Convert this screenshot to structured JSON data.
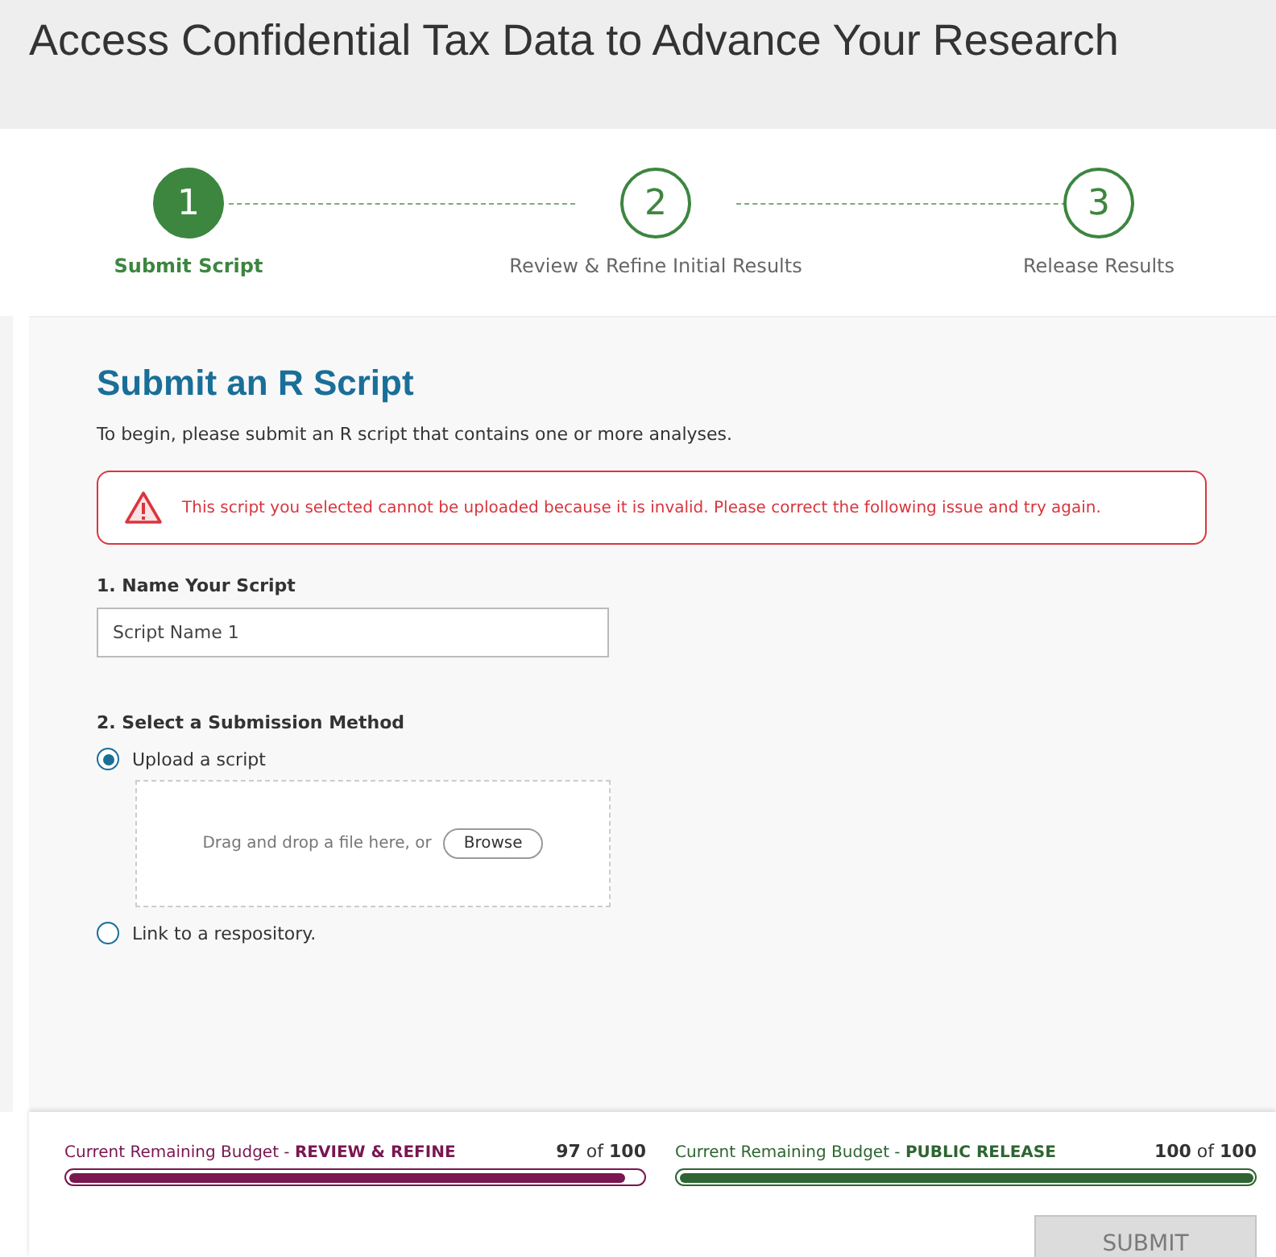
{
  "header": {
    "title": "Access Confidential Tax Data to Advance Your Research"
  },
  "steps": [
    {
      "number": "1",
      "label": "Submit Script",
      "selected": true
    },
    {
      "number": "2",
      "label": "Review & Refine Initial Results",
      "selected": false
    },
    {
      "number": "3",
      "label": "Release Results",
      "selected": false
    }
  ],
  "form": {
    "title": "Submit an R Script",
    "intro": "To begin, please submit an R script that contains one or more analyses.",
    "error": "This script you selected cannot be uploaded because it is invalid. Please correct the following issue and try again.",
    "name_label": "1. Name Your Script",
    "name_value": "Script Name 1",
    "method_label": "2. Select a Submission Method",
    "methods": [
      {
        "label": "Upload a script",
        "selected": true,
        "dropzone": {
          "text": "Drag and drop a file here, or",
          "button": "Browse"
        }
      },
      {
        "label": "Link to a respository.",
        "selected": false
      }
    ]
  },
  "budgets": [
    {
      "label": "Current Remaining Budget - **REVIEW & REFINE**",
      "reading": "**97** of **100**",
      "level": 0.97,
      "color": "#7a1650"
    },
    {
      "label": "Current Remaining Budget - **PUBLIC RELEASE**",
      "reading": "**100** of **100**",
      "level": 1.0,
      "color": "#2e6532"
    }
  ],
  "submit": {
    "label": "SUBMIT",
    "disabled": true
  }
}
